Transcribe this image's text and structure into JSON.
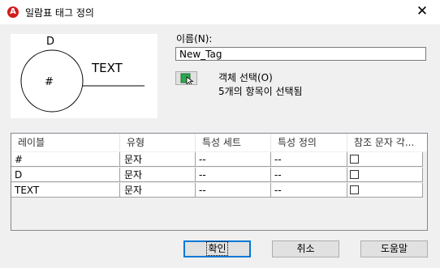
{
  "window": {
    "title": "일람표 태그 정의",
    "app_icon_letter": "A",
    "close_glyph": "✕"
  },
  "preview": {
    "letter_top": "D",
    "center_text": "#",
    "right_text": "TEXT"
  },
  "name": {
    "label": "이름(N):",
    "value": "New_Tag"
  },
  "object_select": {
    "title": "객체 선택(O)",
    "count_text": "5개의 항목이 선택됨",
    "icon": "select-objects-icon",
    "accent": "#2fa84f"
  },
  "table": {
    "columns": [
      "레이블",
      "유형",
      "특성 세트",
      "특성 정의",
      "참조 문자 각..."
    ],
    "rows": [
      {
        "label": "#",
        "type": "문자",
        "prop_set": "--",
        "prop_def": "--",
        "checked": false
      },
      {
        "label": "D",
        "type": "문자",
        "prop_set": "--",
        "prop_def": "--",
        "checked": false
      },
      {
        "label": "TEXT",
        "type": "문자",
        "prop_set": "--",
        "prop_def": "--",
        "checked": false
      }
    ]
  },
  "buttons": {
    "ok": "확인",
    "cancel": "취소",
    "help": "도움말"
  }
}
